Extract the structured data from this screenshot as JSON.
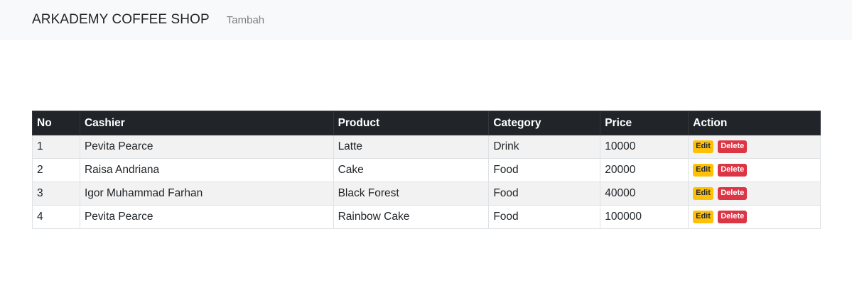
{
  "navbar": {
    "brand": "ARKADEMY COFFEE SHOP",
    "link": "Tambah"
  },
  "table": {
    "headers": [
      "No",
      "Cashier",
      "Product",
      "Category",
      "Price",
      "Action"
    ],
    "rows": [
      {
        "no": "1",
        "cashier": "Pevita Pearce",
        "product": "Latte",
        "category": "Drink",
        "price": "10000"
      },
      {
        "no": "2",
        "cashier": "Raisa Andriana",
        "product": "Cake",
        "category": "Food",
        "price": "20000"
      },
      {
        "no": "3",
        "cashier": "Igor Muhammad Farhan",
        "product": "Black Forest",
        "category": "Food",
        "price": "40000"
      },
      {
        "no": "4",
        "cashier": "Pevita Pearce",
        "product": "Rainbow Cake",
        "category": "Food",
        "price": "100000"
      }
    ],
    "actions": {
      "edit_label": "Edit",
      "delete_label": "Delete"
    }
  },
  "colors": {
    "navbar_bg": "#f8f9fa",
    "header_bg": "#212529",
    "edit_badge": "#ffc107",
    "delete_badge": "#dc3545",
    "stripe": "#f2f2f2"
  }
}
